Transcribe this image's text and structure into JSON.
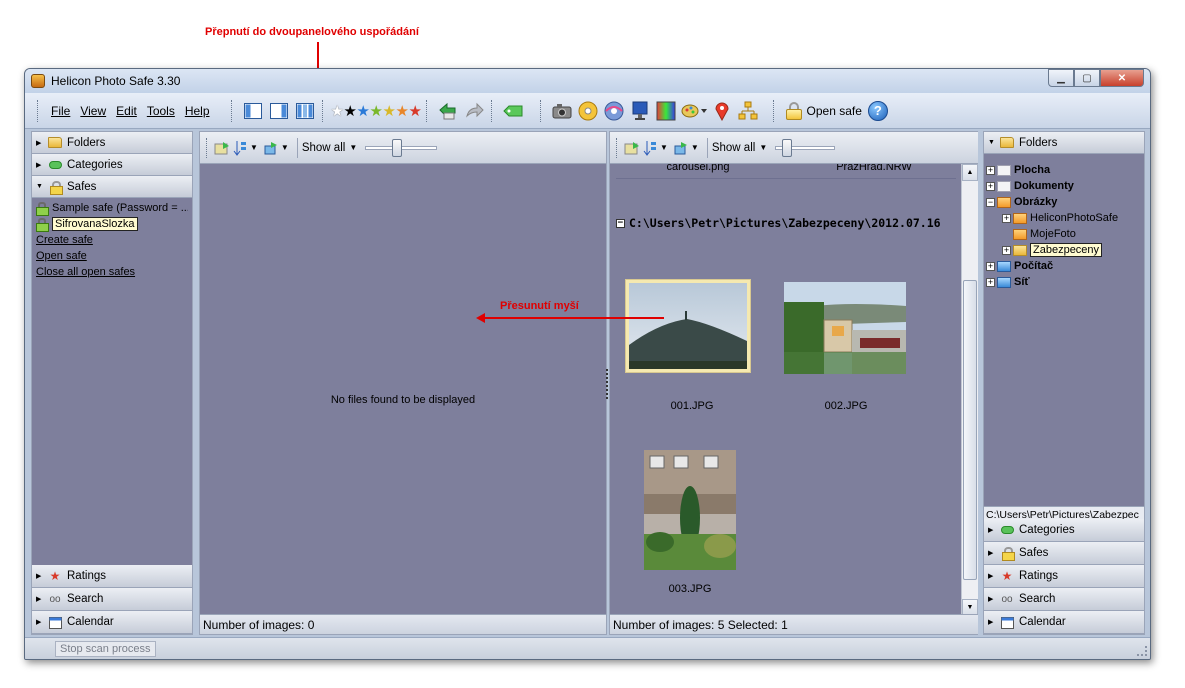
{
  "annotations": {
    "layout_switch": "Přepnutí do dvoupanelového uspořádání",
    "drag_mouse": "Přesunutí myší"
  },
  "window": {
    "title": "Helicon Photo Safe 3.30",
    "minimize": "▁",
    "maximize": "▢",
    "close": "✕"
  },
  "menu": {
    "file": "File",
    "view": "View",
    "edit": "Edit",
    "tools": "Tools",
    "help": "Help"
  },
  "toolbar": {
    "open_safe": "Open safe",
    "help_icon": "?"
  },
  "left_panel": {
    "folders": "Folders",
    "categories": "Categories",
    "safes": "Safes",
    "safes_items": [
      "Sample safe (Password = ...",
      "SifrovanaSlozka"
    ],
    "create_safe": "Create safe",
    "open_safe": "Open safe",
    "close_all": "Close all open safes",
    "ratings": "Ratings",
    "search": "Search",
    "calendar": "Calendar"
  },
  "left_view": {
    "show_all": "Show all",
    "empty_message": "No files found to be displayed",
    "status": "Number of images: 0"
  },
  "right_view": {
    "show_all": "Show all",
    "cut_files": [
      "carousel.png",
      "PrazHrad.NRW"
    ],
    "group_path": "C:\\Users\\Petr\\Pictures\\Zabezpeceny\\2012.07.16",
    "images": [
      "001.JPG",
      "002.JPG",
      "003.JPG"
    ],
    "status": "Number of images: 5 Selected: 1"
  },
  "right_panel": {
    "folders": "Folders",
    "tree": [
      {
        "label": "Plocha",
        "bold": true
      },
      {
        "label": "Dokumenty",
        "bold": true
      },
      {
        "label": "Obrázky",
        "bold": true
      },
      {
        "label": "HeliconPhotoSafe",
        "bold": false
      },
      {
        "label": "MojeFoto",
        "bold": false
      },
      {
        "label": "Zabezpeceny",
        "bold": false
      },
      {
        "label": "Počítač",
        "bold": true
      },
      {
        "label": "Síť",
        "bold": true
      }
    ],
    "path": "C:\\Users\\Petr\\Pictures\\Zabezpec",
    "categories": "Categories",
    "safes": "Safes",
    "ratings": "Ratings",
    "search": "Search",
    "calendar": "Calendar"
  },
  "statusbar": {
    "stop_scan": "Stop scan process"
  },
  "colors": {
    "panel_bg": "#7e7f9c",
    "annotation": "#e00000"
  }
}
